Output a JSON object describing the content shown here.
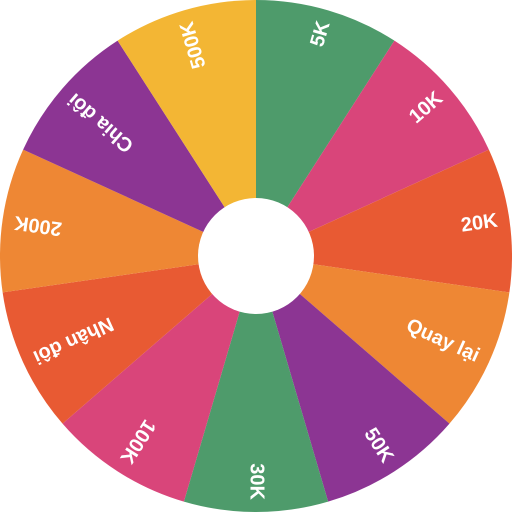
{
  "wheel": {
    "segments": [
      {
        "label": "5K",
        "color": "#4e9b6b"
      },
      {
        "label": "10K",
        "color": "#d9457a"
      },
      {
        "label": "20K",
        "color": "#e85a33"
      },
      {
        "label": "Quay lại",
        "color": "#ee8734"
      },
      {
        "label": "50K",
        "color": "#8c3593"
      },
      {
        "label": "30K",
        "color": "#4e9b6b"
      },
      {
        "label": "100K",
        "color": "#d9457a"
      },
      {
        "label": "Nhân đôi",
        "color": "#e85a33"
      },
      {
        "label": "200K",
        "color": "#ee8734"
      },
      {
        "label": "Chia đôi",
        "color": "#8c3593"
      },
      {
        "label": "500K",
        "color": "#f3b634"
      }
    ],
    "hub_color": "#ffffff",
    "text_color": "#ffffff"
  }
}
